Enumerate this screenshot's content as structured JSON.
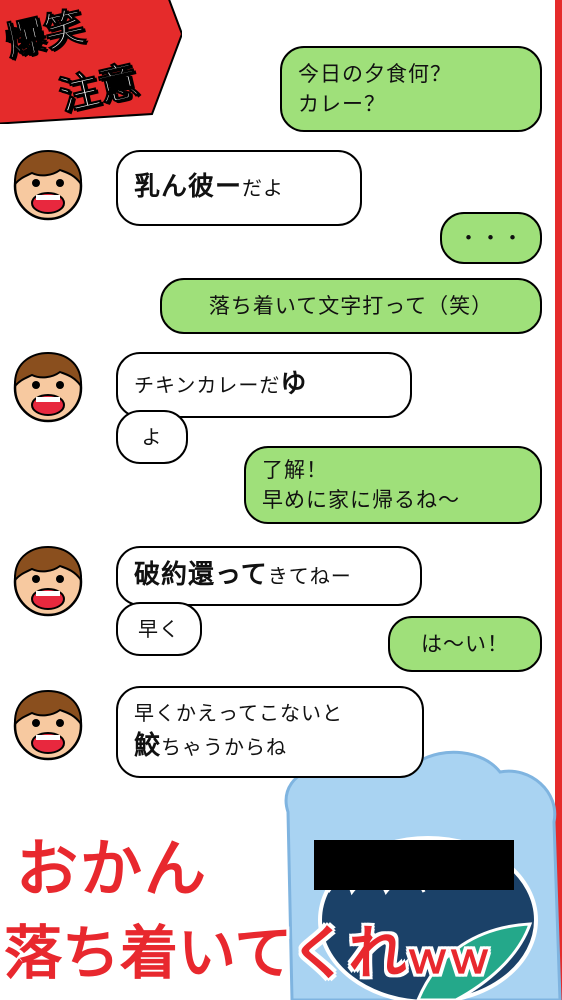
{
  "badge": {
    "line1": "爆笑",
    "line2": "注意"
  },
  "messages": [
    {
      "id": "m1",
      "side": "right",
      "color": "green",
      "lines": [
        "今日の夕食何？",
        "カレー？"
      ]
    },
    {
      "id": "m2",
      "side": "left",
      "color": "white",
      "bold": "乳ん彼ー",
      "rest": "だよ"
    },
    {
      "id": "m3",
      "side": "right",
      "color": "green",
      "text": "・・・"
    },
    {
      "id": "m4",
      "side": "right",
      "color": "green",
      "text": "落ち着いて文字打って（笑）"
    },
    {
      "id": "m5",
      "side": "left",
      "color": "white",
      "pre": "チキンカレーだ",
      "bold": "ゆ"
    },
    {
      "id": "m6",
      "side": "left",
      "color": "white",
      "text": "よ"
    },
    {
      "id": "m7",
      "side": "right",
      "color": "green",
      "lines": [
        "了解！",
        "早めに家に帰るね～"
      ]
    },
    {
      "id": "m8",
      "side": "left",
      "color": "white",
      "bold": "破約還って",
      "rest": "きてねー"
    },
    {
      "id": "m9",
      "side": "left",
      "color": "white",
      "text": "早く"
    },
    {
      "id": "m10",
      "side": "right",
      "color": "green",
      "text": "は～い！"
    },
    {
      "id": "m11",
      "side": "left",
      "color": "white",
      "line1": "早くかえってこないと",
      "bold": "鮫",
      "rest": "ちゃうからね"
    }
  ],
  "banner": {
    "line1": "おかん",
    "line2": "落ち着いてくれ",
    "suffix": "ｗｗ"
  },
  "colors": {
    "green": "#9fe07a",
    "red": "#e8282e",
    "white": "#ffffff"
  },
  "icons": [
    "mother-avatar-icon",
    "sea-monster-mascot-icon",
    "ribbon-badge-icon"
  ]
}
